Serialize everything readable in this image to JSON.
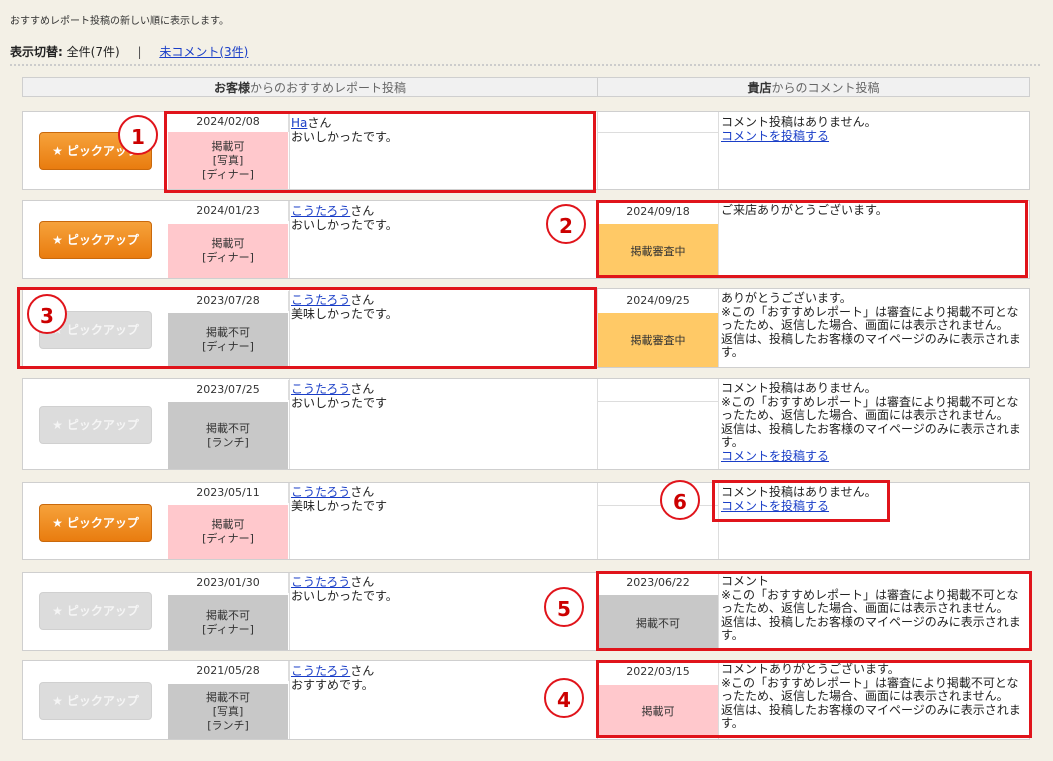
{
  "intro": "おすすめレポート投稿の新しい順に表示します。",
  "filter": {
    "label": "表示切替:",
    "all": "全件(7件)",
    "separator": "|",
    "uncommented": "未コメント(3件)"
  },
  "headers": {
    "left_strong": "お客様",
    "left_rest": "からのおすすめレポート投稿",
    "right_strong": "貴店",
    "right_rest": "からのコメント投稿"
  },
  "pickup_label": "ピックアップ",
  "rows": [
    {
      "date": "2024/02/08",
      "status": "掲載可\n[写真]\n[ディナー]",
      "user": "Ha",
      "suffix": "さん",
      "text": "おいしかったです。",
      "reply_date": "",
      "reply_status": "",
      "reply": "コメント投稿はありません。",
      "reply_link": "コメントを投稿する"
    },
    {
      "date": "2024/01/23",
      "status": "掲載可\n[ディナー]",
      "user": "こうたろう",
      "suffix": "さん",
      "text": "おいしかったです。",
      "reply_date": "2024/09/18",
      "reply_status": "掲載審査中",
      "reply": "ご来店ありがとうございます。",
      "reply_link": ""
    },
    {
      "date": "2023/07/28",
      "status": "掲載不可\n[ディナー]",
      "user": "こうたろう",
      "suffix": "さん",
      "text": "美味しかったです。",
      "reply_date": "2024/09/25",
      "reply_status": "掲載審査中",
      "reply": "ありがとうございます。\n※この「おすすめレポート」は審査により掲載不可となったため、返信した場合、画面には表示されません。\n返信は、投稿したお客様のマイページのみに表示されます。",
      "reply_link": ""
    },
    {
      "date": "2023/07/25",
      "status": "掲載不可\n[ランチ]",
      "user": "こうたろう",
      "suffix": "さん",
      "text": "おいしかったです",
      "reply_date": "",
      "reply_status": "",
      "reply": "コメント投稿はありません。\n※この「おすすめレポート」は審査により掲載不可となったため、返信した場合、画面には表示されません。\n返信は、投稿したお客様のマイページのみに表示されます。",
      "reply_link": "コメントを投稿する"
    },
    {
      "date": "2023/05/11",
      "status": "掲載可\n[ディナー]",
      "user": "こうたろう",
      "suffix": "さん",
      "text": "美味しかったです",
      "reply_date": "",
      "reply_status": "",
      "reply": "コメント投稿はありません。",
      "reply_link": "コメントを投稿する"
    },
    {
      "date": "2023/01/30",
      "status": "掲載不可\n[ディナー]",
      "user": "こうたろう",
      "suffix": "さん",
      "text": "おいしかったです。",
      "reply_date": "2023/06/22",
      "reply_status": "掲載不可",
      "reply": "コメント\n※この「おすすめレポート」は審査により掲載不可となったため、返信した場合、画面には表示されません。\n返信は、投稿したお客様のマイページのみに表示されます。",
      "reply_link": ""
    },
    {
      "date": "2021/05/28",
      "status": "掲載不可\n[写真]\n[ランチ]",
      "user": "こうたろう",
      "suffix": "さん",
      "text": "おすすめです。",
      "reply_date": "2022/03/15",
      "reply_status": "掲載可",
      "reply": "コメントありがとうございます。\n※この「おすすめレポート」は審査により掲載不可となったため、返信した場合、画面には表示されません。\n返信は、投稿したお客様のマイページのみに表示されます。",
      "reply_link": ""
    }
  ],
  "annotations": [
    "1",
    "2",
    "3",
    "4",
    "5",
    "6"
  ],
  "colors": {
    "accent": "#e0141b",
    "pink": "#ffc8cc",
    "orange": "#ffc966",
    "gray": "#c8c8c8"
  }
}
